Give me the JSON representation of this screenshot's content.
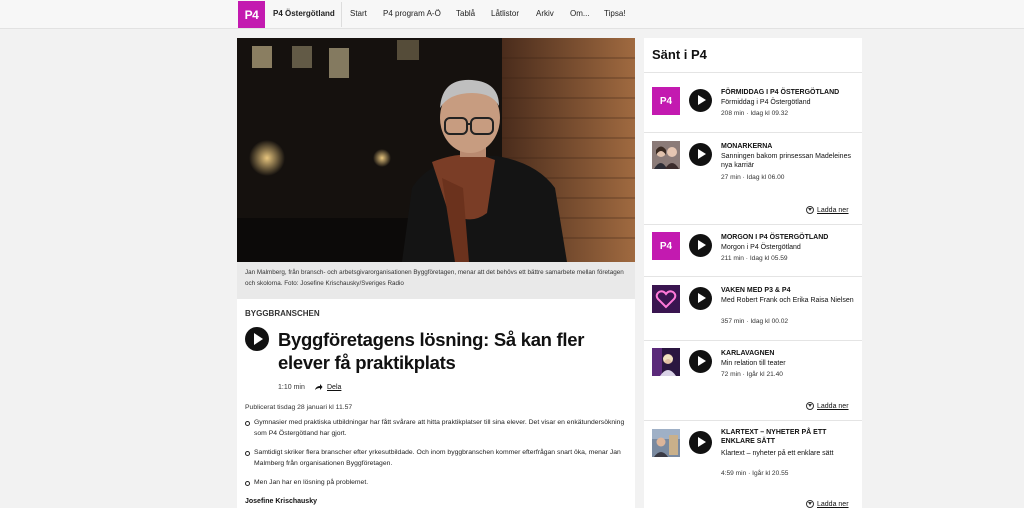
{
  "nav": {
    "logo": "P4",
    "station": "P4 Östergötland",
    "items": [
      "Start",
      "P4 program A-Ö",
      "Tablå",
      "Låtlistor",
      "Arkiv",
      "Om...",
      "Tipsa!"
    ]
  },
  "article": {
    "caption": "Jan Malmberg, från bransch- och arbetsgivarorganisationen Byggföretagen, menar att det behövs ett bättre samarbete mellan företagen och skolorna. Foto: Josefine Krischausky/Sveriges Radio",
    "kicker": "BYGGBRANSCHEN",
    "headline": "Byggföretagens lösning: Så kan fler elever få praktikplats",
    "duration": "1:10 min",
    "share_label": "Dela",
    "published": "Publicerat tisdag 28 januari kl 11.57",
    "bullets": [
      "Gymnasier med praktiska utbildningar har fått svårare att hitta praktikplatser till sina elever. Det visar en enkätundersökning som P4 Östergötland har gjort.",
      "Samtidigt skriker flera branscher efter yrkesutbildade. Och inom byggbranschen kommer efterfrågan snart öka, menar Jan Malmberg från organisationen Byggföretagen.",
      "Men Jan har en lösning på problemet."
    ],
    "author": "Josefine Krischausky"
  },
  "sidebar": {
    "title": "Sänt i P4",
    "download_label": "Ladda ner",
    "episodes": [
      {
        "program": "FÖRMIDDAG I P4 ÖSTERGÖTLAND",
        "title": "Förmiddag i P4 Östergötland",
        "meta": "208 min  ·  Idag kl 09.32",
        "thumb": "P4"
      },
      {
        "program": "MONARKERNA",
        "title": "Sanningen bakom prinsessan Madeleines nya karriär",
        "meta": "27 min  ·  Idag kl 06.00"
      },
      {
        "program": "MORGON I P4 ÖSTERGÖTLAND",
        "title": "Morgon i P4 Östergötland",
        "meta": "211 min  ·  Idag kl 05.59",
        "thumb": "P4"
      },
      {
        "program": "VAKEN MED P3 & P4",
        "title": "Med Robert Frank och Erika Raisa Nielsen",
        "meta": "357 min  ·  Idag kl 00.02"
      },
      {
        "program": "KARLAVAGNEN",
        "title": "Min relation till teater",
        "meta": "72 min  ·  Igår kl 21.40"
      },
      {
        "program": "KLARTEXT – NYHETER PÅ ETT ENKLARE SÄTT",
        "title": "Klartext – nyheter på ett enklare sätt",
        "meta": "4:59 min  ·  Igår kl 20.55"
      }
    ]
  },
  "colors": {
    "brand": "#c31ab0",
    "text": "#111111",
    "page_bg": "#f2f2f2"
  }
}
